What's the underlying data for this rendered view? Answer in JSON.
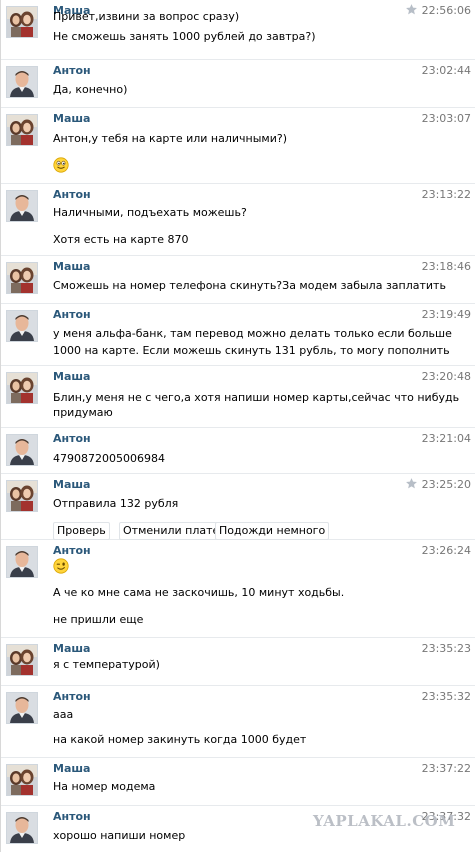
{
  "users": {
    "masha": {
      "name": "Маша",
      "avatar_icon": "masha-photo-avatar-icon"
    },
    "anton": {
      "name": "Антон",
      "avatar_icon": "anton-photo-avatar-icon"
    }
  },
  "messages": [
    {
      "author": "Маша",
      "time": "22:56:06",
      "starred": true,
      "lines": [
        "Привет,извини за вопрос сразу)",
        "Не сможешь занять 1000 рублей до завтра?)"
      ]
    },
    {
      "author": "Антон",
      "time": "23:02:44",
      "lines": [
        "Да, конечно)"
      ]
    },
    {
      "author": "Маша",
      "time": "23:03:07",
      "lines": [
        "Антон,у тебя на карте или наличными?)"
      ],
      "emoji": "smile-emoji-icon"
    },
    {
      "author": "Антон",
      "time": "23:13:22",
      "lines": [
        "Наличными, подъехать можешь?",
        "Хотя есть на карте 870"
      ]
    },
    {
      "author": "Маша",
      "time": "23:18:46",
      "lines": [
        "Сможешь на номер телефона скинуть?За модем забыла заплатить"
      ]
    },
    {
      "author": "Антон",
      "time": "23:19:49",
      "lines": [
        "у меня альфа-банк, там перевод можно делать только если больше",
        "1000 на карте. Если можешь скинуть 131 рубль, то могу пополнить"
      ]
    },
    {
      "author": "Маша",
      "time": "23:20:48",
      "lines": [
        "Блин,у меня не с чего,а хотя напиши номер карты,сейчас что нибудь",
        "придумаю"
      ]
    },
    {
      "author": "Антон",
      "time": "23:21:04",
      "lines": [
        "4790872005006984"
      ]
    },
    {
      "author": "Маша",
      "time": "23:25:20",
      "starred": true,
      "lines": [
        "Отправила 132 рубля"
      ],
      "quick_replies": [
        "Проверь",
        "Отменили платеж",
        "Подожди немного"
      ]
    },
    {
      "author": "Антон",
      "time": "23:26:24",
      "emoji": "wink-emoji-icon",
      "lines": [
        "А че ко мне сама не заскочишь, 10 минут ходьбы.",
        "не пришли еще"
      ]
    },
    {
      "author": "Маша",
      "time": "23:35:23",
      "lines": [
        "я с температурой)"
      ]
    },
    {
      "author": "Антон",
      "time": "23:35:32",
      "lines": [
        "ааа",
        "на какой номер закинуть когда 1000 будет"
      ]
    },
    {
      "author": "Маша",
      "time": "23:37:22",
      "lines": [
        "На номер модема"
      ]
    },
    {
      "author": "Антон",
      "time": "23:37:32",
      "lines": [
        "хорошо  напиши номер"
      ]
    }
  ],
  "watermark": "YAPLAKAL.COM",
  "colors": {
    "author": "#2b587a",
    "time": "#777777",
    "separator": "#e7eaed",
    "watermark": "#b8bcc3"
  }
}
